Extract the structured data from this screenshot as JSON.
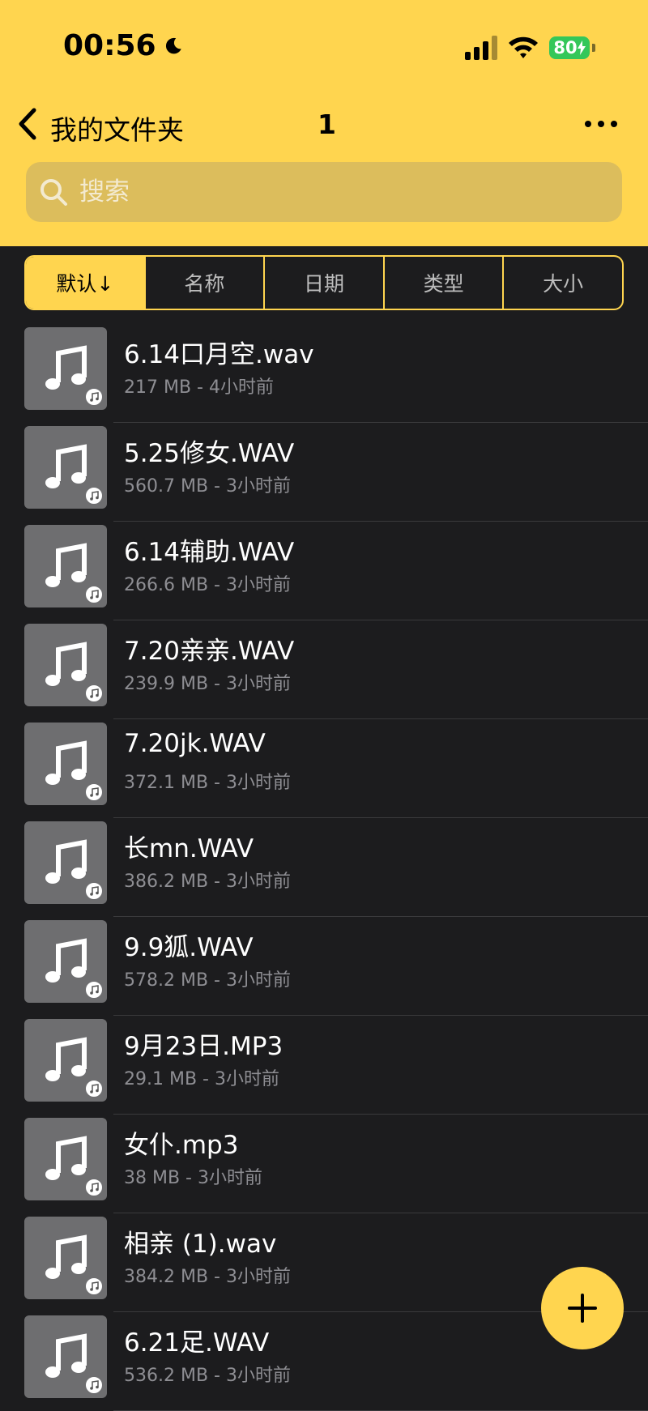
{
  "status_bar": {
    "time": "00:56",
    "battery": "80"
  },
  "nav": {
    "title": "我的文件夹",
    "count": "1"
  },
  "search": {
    "placeholder": "搜索"
  },
  "tabs": [
    {
      "label": "默认↓",
      "active": true
    },
    {
      "label": "名称"
    },
    {
      "label": "日期"
    },
    {
      "label": "类型"
    },
    {
      "label": "大小"
    }
  ],
  "files": [
    {
      "name": "6.14口月空.wav",
      "meta": "217 MB - 4小时前"
    },
    {
      "name": "5.25修女.WAV",
      "meta": "560.7 MB - 3小时前"
    },
    {
      "name": "6.14辅助.WAV",
      "meta": "266.6 MB - 3小时前"
    },
    {
      "name": "7.20亲亲.WAV",
      "meta": "239.9 MB - 3小时前"
    },
    {
      "name": "7.20jk.WAV",
      "meta": "372.1 MB - 3小时前"
    },
    {
      "name": "长mn.WAV",
      "meta": "386.2 MB - 3小时前"
    },
    {
      "name": "9.9狐.WAV",
      "meta": "578.2 MB - 3小时前"
    },
    {
      "name": "9月23日.MP3",
      "meta": "29.1 MB - 3小时前"
    },
    {
      "name": "女仆.mp3",
      "meta": "38 MB - 3小时前"
    },
    {
      "name": "相亲 (1).wav",
      "meta": "384.2 MB - 3小时前"
    },
    {
      "name": "6.21足.WAV",
      "meta": "536.2 MB - 3小时前"
    }
  ],
  "colors": {
    "accent": "#ffd54f",
    "background": "#1c1c1e",
    "thumb": "#6e6e70"
  },
  "icons": {
    "file": "music-note-icon",
    "add": "plus-icon"
  }
}
